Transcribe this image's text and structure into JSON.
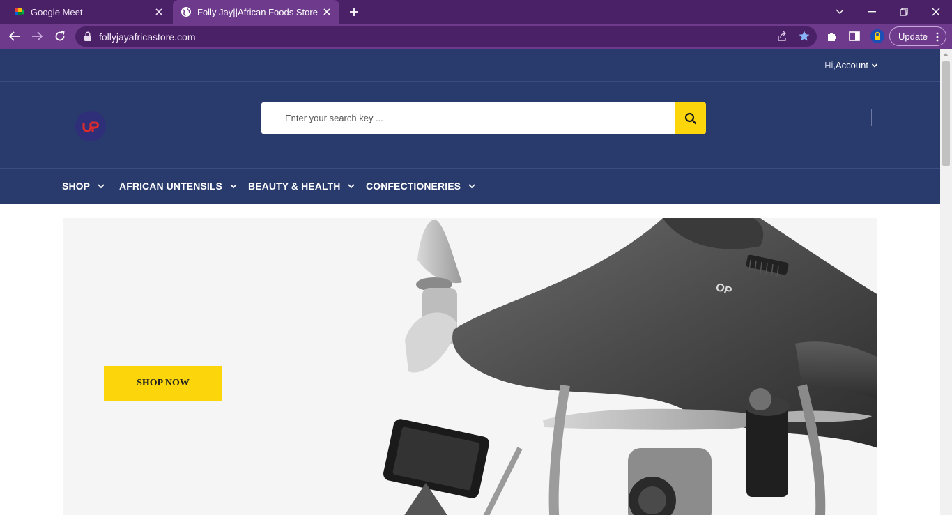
{
  "browser": {
    "tabs": [
      {
        "title": "Google Meet",
        "icon": "google-meet-icon",
        "active": false
      },
      {
        "title": "Folly Jay||African Foods Store",
        "icon": "globe-icon",
        "active": true
      }
    ],
    "url": "follyjayafricastore.com",
    "update_label": "Update"
  },
  "site": {
    "account": {
      "greeting": "Hi,",
      "label": "Account"
    },
    "search": {
      "placeholder": "Enter your search key ..."
    },
    "nav": [
      {
        "label": "SHOP"
      },
      {
        "label": "AFRICAN UNTENSILS"
      },
      {
        "label": "BEAUTY & HEALTH"
      },
      {
        "label": "CONFECTIONERIES"
      }
    ],
    "banner": {
      "cta_label": "SHOP NOW"
    }
  },
  "colors": {
    "brand_navy": "#293a6d",
    "accent_yellow": "#fcd50a",
    "chrome_purple": "#6e3a8c",
    "chrome_dark": "#4a2066",
    "logo_red": "#e02b2b"
  }
}
